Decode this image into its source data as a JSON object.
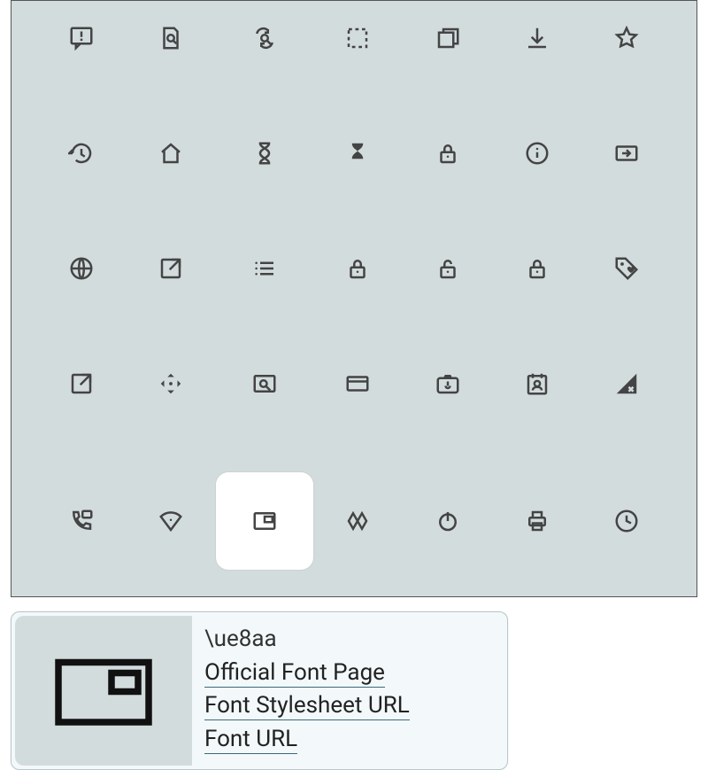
{
  "grid": {
    "rows": [
      [
        "feedback-icon",
        "find-in-page-icon",
        "find-replace-icon",
        "marquee-select-icon",
        "restore-window-icon",
        "download-icon",
        "star-outline-icon"
      ],
      [
        "history-icon",
        "home-icon",
        "hourglass-empty-icon",
        "hourglass-full-icon",
        "lock-icon",
        "info-icon",
        "input-icon"
      ],
      [
        "language-icon",
        "launch-icon",
        "list-icon",
        "lock-closed-icon",
        "lock-open-icon",
        "lock-alt-icon",
        "loyalty-icon"
      ],
      [
        "open-in-new-icon",
        "open-with-icon",
        "pageview-icon",
        "payment-icon",
        "perm-camera-mic-icon",
        "perm-contact-calendar-icon",
        "signal-disabled-icon"
      ],
      [
        "perm-phone-msg-icon",
        "perm-scan-wifi-icon",
        "picture-in-picture-icon",
        "polymer-icon",
        "power-icon",
        "print-icon",
        "query-builder-icon"
      ]
    ],
    "selected": {
      "row": 4,
      "col": 2
    }
  },
  "detail": {
    "codepoint": "\\ue8aa",
    "links": {
      "official": "Official Font Page",
      "stylesheet": "Font Stylesheet URL",
      "font": "Font URL"
    }
  }
}
